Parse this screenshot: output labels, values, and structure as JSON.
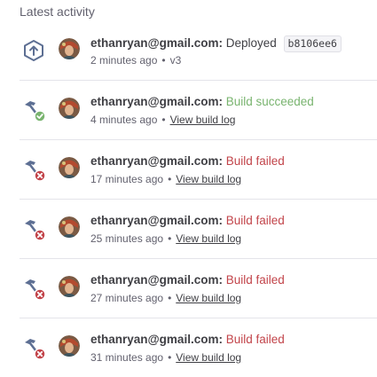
{
  "heading": "Latest activity",
  "colors": {
    "success": "#79b46f",
    "failed": "#c2444a",
    "text": "#3f3f44",
    "muted": "#62616e"
  },
  "items": [
    {
      "type": "deploy",
      "icon": "deploy-icon",
      "user": "ethanryan@gmail.com:",
      "message": "Deployed",
      "sha": "b8106ee6",
      "time": "2 minutes ago",
      "detail": "v3"
    },
    {
      "type": "build-success",
      "icon": "hammer-check-icon",
      "user": "ethanryan@gmail.com:",
      "message": "Build succeeded",
      "time": "4 minutes ago",
      "link": "View build log"
    },
    {
      "type": "build-failed",
      "icon": "hammer-fail-icon",
      "user": "ethanryan@gmail.com:",
      "message": "Build failed",
      "time": "17 minutes ago",
      "link": "View build log"
    },
    {
      "type": "build-failed",
      "icon": "hammer-fail-icon",
      "user": "ethanryan@gmail.com:",
      "message": "Build failed",
      "time": "25 minutes ago",
      "link": "View build log"
    },
    {
      "type": "build-failed",
      "icon": "hammer-fail-icon",
      "user": "ethanryan@gmail.com:",
      "message": "Build failed",
      "time": "27 minutes ago",
      "link": "View build log"
    },
    {
      "type": "build-failed",
      "icon": "hammer-fail-icon",
      "user": "ethanryan@gmail.com:",
      "message": "Build failed",
      "time": "31 minutes ago",
      "link": "View build log"
    }
  ]
}
